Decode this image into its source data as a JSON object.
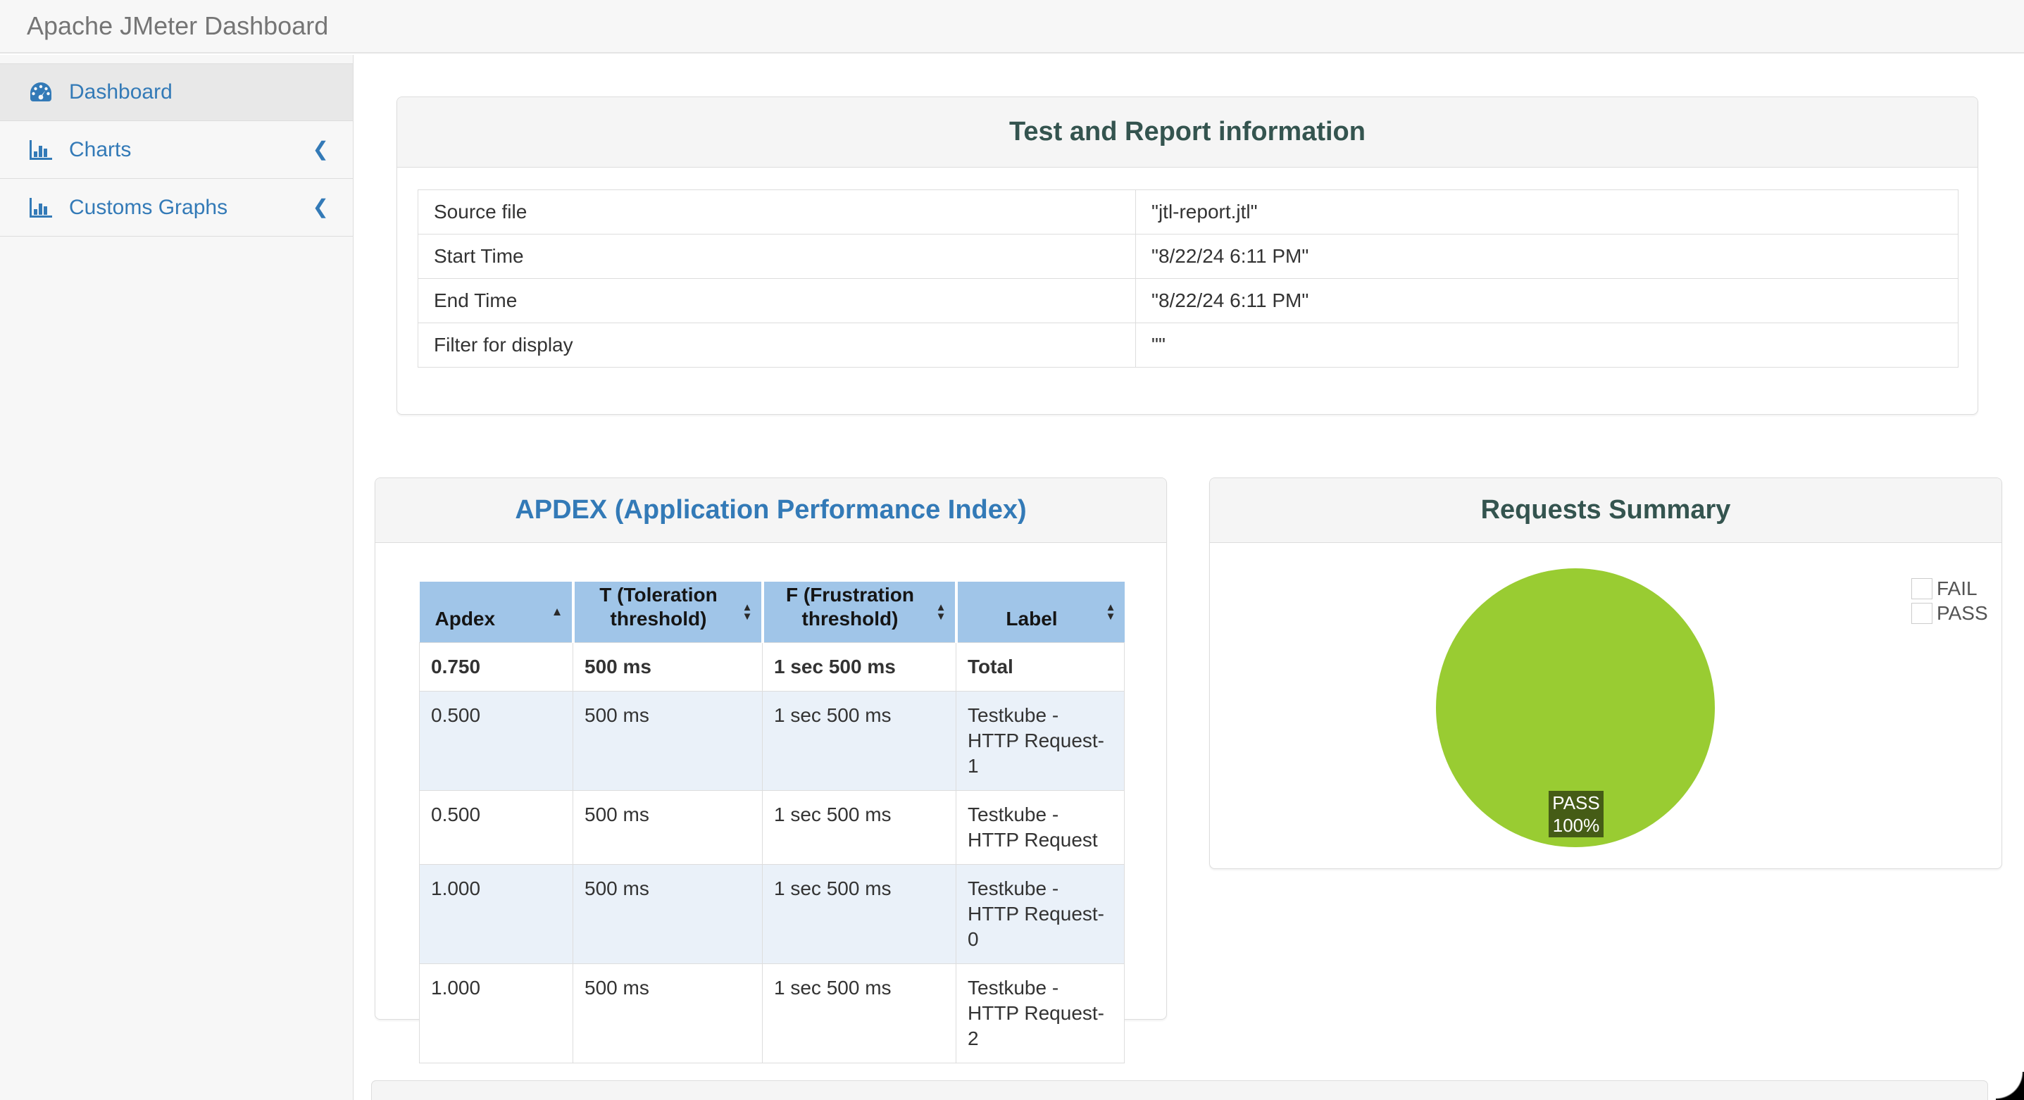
{
  "app": {
    "title": "Apache JMeter Dashboard"
  },
  "sidebar": {
    "items": [
      {
        "label": "Dashboard",
        "icon": "tachometer-icon",
        "active": true,
        "collapsible": false
      },
      {
        "label": "Charts",
        "icon": "bar-chart-icon",
        "active": false,
        "collapsible": true
      },
      {
        "label": "Customs Graphs",
        "icon": "bar-chart-icon",
        "active": false,
        "collapsible": true
      }
    ]
  },
  "icons": {
    "sort_asc": "▲",
    "sort_up": "▲",
    "sort_down": "▼",
    "chevron_left": "❮"
  },
  "test_info": {
    "title": "Test and Report information",
    "rows": [
      {
        "label": "Source file",
        "value": "\"jtl-report.jtl\""
      },
      {
        "label": "Start Time",
        "value": "\"8/22/24 6:11 PM\""
      },
      {
        "label": "End Time",
        "value": "\"8/22/24 6:11 PM\""
      },
      {
        "label": "Filter for display",
        "value": "\"\""
      }
    ]
  },
  "apdex": {
    "title": "APDEX (Application Performance Index)",
    "columns": [
      "Apdex",
      "T (Toleration threshold)",
      "F (Frustration threshold)",
      "Label"
    ],
    "sorted_column": "Apdex",
    "sort_direction": "ascending",
    "rows": [
      {
        "apdex": "0.750",
        "t": "500 ms",
        "f": "1 sec 500 ms",
        "label": "Total"
      },
      {
        "apdex": "0.500",
        "t": "500 ms",
        "f": "1 sec 500 ms",
        "label": "Testkube - HTTP Request-1"
      },
      {
        "apdex": "0.500",
        "t": "500 ms",
        "f": "1 sec 500 ms",
        "label": "Testkube - HTTP Request"
      },
      {
        "apdex": "1.000",
        "t": "500 ms",
        "f": "1 sec 500 ms",
        "label": "Testkube - HTTP Request-0"
      },
      {
        "apdex": "1.000",
        "t": "500 ms",
        "f": "1 sec 500 ms",
        "label": "Testkube - HTTP Request-2"
      }
    ]
  },
  "requests_summary": {
    "title": "Requests Summary",
    "legend": [
      {
        "label": "FAIL",
        "color": "#f96a4c"
      },
      {
        "label": "PASS",
        "color": "#94c63d"
      }
    ],
    "pie_color": "#99cc32",
    "label_box": {
      "line1": "PASS",
      "line2": "100%"
    },
    "chart_data": {
      "type": "pie",
      "labels": [
        "FAIL",
        "PASS"
      ],
      "values": [
        0,
        100
      ],
      "colors": [
        "#ff6347",
        "#9acd32"
      ],
      "annotations": [
        "PASS 100%"
      ],
      "legend_position": "top-right"
    }
  },
  "colors": {
    "link_blue": "#337ab7",
    "panel_title_teal": "#34544f",
    "table_header_blue": "#a0c5e8",
    "striped_row": "#eaf1f9",
    "pass_green": "#9acd32",
    "fail_red": "#ff6347"
  }
}
